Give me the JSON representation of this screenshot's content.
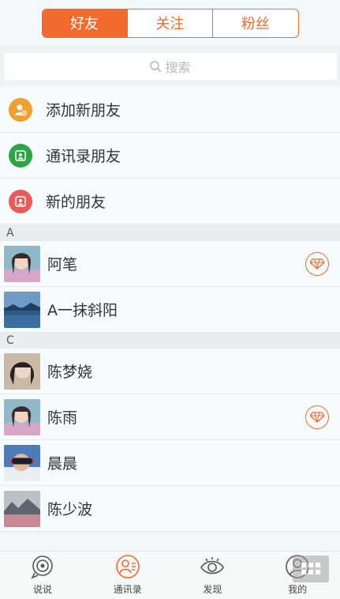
{
  "tabs": [
    "好友",
    "关注",
    "粉丝"
  ],
  "search": {
    "placeholder": "搜索"
  },
  "functions": [
    {
      "label": "添加新朋友",
      "color": "#f0a030",
      "icon": "add-friend-icon"
    },
    {
      "label": "通讯录朋友",
      "color": "#2ea545",
      "icon": "contacts-icon"
    },
    {
      "label": "新的朋友",
      "color": "#ea5a5a",
      "icon": "new-friend-icon"
    }
  ],
  "sections": [
    {
      "letter": "A",
      "contacts": [
        {
          "name": "阿笔",
          "avatar": "avatar-girl",
          "vip": true
        },
        {
          "name": "A一抹斜阳",
          "avatar": "avatar-landscape",
          "vip": false
        }
      ]
    },
    {
      "letter": "C",
      "contacts": [
        {
          "name": "陈梦娆",
          "avatar": "avatar-girl-2",
          "vip": false
        },
        {
          "name": "陈雨",
          "avatar": "avatar-girl",
          "vip": true
        },
        {
          "name": "晨晨",
          "avatar": "avatar-goggles",
          "vip": false
        },
        {
          "name": "陈少波",
          "avatar": "avatar-mountain",
          "vip": false
        }
      ]
    }
  ],
  "tabbar": [
    {
      "label": "说说",
      "icon": "talk-icon"
    },
    {
      "label": "通讯录",
      "icon": "contacts-tab-icon",
      "active": true
    },
    {
      "label": "发现",
      "icon": "eye-icon"
    },
    {
      "label": "我的",
      "icon": "profile-icon"
    }
  ],
  "accent": "#f26a2e"
}
